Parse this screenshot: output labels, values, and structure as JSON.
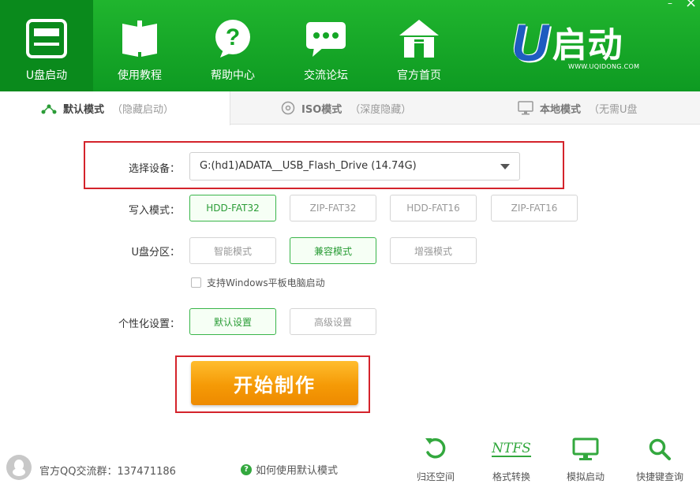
{
  "colors": {
    "brand_green": "#14a626",
    "accent_orange": "#f59a06",
    "highlight_red": "#d4232b",
    "selected_green": "#39b54a"
  },
  "nav": [
    {
      "label": "U盘启动",
      "icon": "usb-drive-icon"
    },
    {
      "label": "使用教程",
      "icon": "book-icon"
    },
    {
      "label": "帮助中心",
      "icon": "help-icon"
    },
    {
      "label": "交流论坛",
      "icon": "chat-bubble-icon"
    },
    {
      "label": "官方首页",
      "icon": "home-icon"
    }
  ],
  "logo": {
    "u": "U",
    "text": "启动",
    "url": "WWW.UQIDONG.COM"
  },
  "window": {
    "minimize": "–",
    "close": "×"
  },
  "tabs": [
    {
      "name": "默认模式",
      "sub": "（隐藏启动）",
      "icon": "tree-icon"
    },
    {
      "name": "ISO模式",
      "sub": "（深度隐藏）",
      "icon": "disc-icon"
    },
    {
      "name": "本地模式",
      "sub": "（无需U盘",
      "icon": "monitor-icon"
    }
  ],
  "form": {
    "device_label": "选择设备：",
    "device_value": "G:(hd1)ADATA__USB_Flash_Drive (14.74G)",
    "write_label": "写入模式：",
    "write_modes": [
      "HDD-FAT32",
      "ZIP-FAT32",
      "HDD-FAT16",
      "ZIP-FAT16"
    ],
    "partition_label": "U盘分区：",
    "partitions": [
      "智能模式",
      "兼容模式",
      "增强模式"
    ],
    "tablet_checkbox": "支持Windows平板电脑启动",
    "custom_label": "个性化设置：",
    "custom_options": [
      "默认设置",
      "高级设置"
    ],
    "start_button": "开始制作"
  },
  "footer": {
    "qq_group": "官方QQ交流群：137471186",
    "help_link": "如何使用默认模式",
    "help_icon_glyph": "?",
    "tools": [
      {
        "label": "归还空间",
        "icon": "restore-icon"
      },
      {
        "label": "格式转换",
        "icon": "ntfs-icon",
        "glyph": "NTFS"
      },
      {
        "label": "模拟启动",
        "icon": "monitor-icon"
      },
      {
        "label": "快捷键查询",
        "icon": "search-icon"
      }
    ]
  }
}
